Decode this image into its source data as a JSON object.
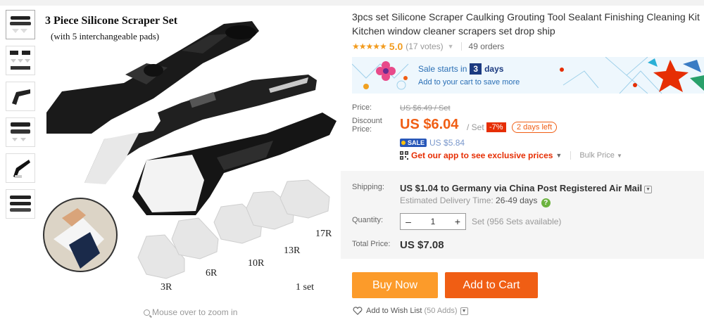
{
  "product": {
    "title_line1": "3pcs set Silicone Scraper Caulking Grouting Tool Sealant Finishing Cleaning Kit",
    "title_line2": "Kitchen window cleaner scrapers set drop ship",
    "stars": "★★★★★",
    "score": "5.0",
    "votes": "(17 votes)",
    "orders": "49 orders"
  },
  "gallery": {
    "image_title": "3 Piece Silicone Scraper Set",
    "image_subtitle": "(with 5 interchangeable pads)",
    "pad_labels": [
      "3R",
      "6R",
      "10R",
      "13R",
      "17R"
    ],
    "set_label": "1 set",
    "zoom_hint": "Mouse over to zoom in",
    "thumbnail_count": 6
  },
  "banner": {
    "sale_prefix": "Sale starts in",
    "sale_days": "3",
    "sale_suffix": "days",
    "sub": "Add to your cart to save more"
  },
  "pricing": {
    "price_label": "Price:",
    "original_price": "US $6.49 / Set",
    "discount_label_1": "Discount",
    "discount_label_2": "Price:",
    "current_price": "US $6.04",
    "per_unit": "/ Set",
    "discount_pct": "-7%",
    "days_left": "2 days left",
    "sale_badge": "SALE",
    "sale_price": "US $5.84",
    "app_promo": "Get our app to see exclusive prices",
    "bulk_price": "Bulk Price"
  },
  "shipping": {
    "label": "Shipping:",
    "value": "US $1.04 to Germany via China Post Registered Air Mail",
    "estimated_label": "Estimated Delivery Time:",
    "estimated_value": "26-49 days"
  },
  "quantity": {
    "label": "Quantity:",
    "value": "1",
    "minus": "–",
    "plus": "+",
    "available": "Set (956 Sets available)"
  },
  "total": {
    "label": "Total Price:",
    "value": "US $7.08"
  },
  "actions": {
    "buy_now": "Buy Now",
    "add_to_cart": "Add to Cart",
    "wishlist": "Add to Wish List",
    "wishlist_count": "(50 Adds)"
  },
  "colors": {
    "price_orange": "#f05e14",
    "buy_now": "#fc9b2a",
    "add_to_cart": "#f05e14",
    "star": "#f29b1d",
    "discount_red": "#e62e04",
    "sale_blue": "#2857b8"
  }
}
